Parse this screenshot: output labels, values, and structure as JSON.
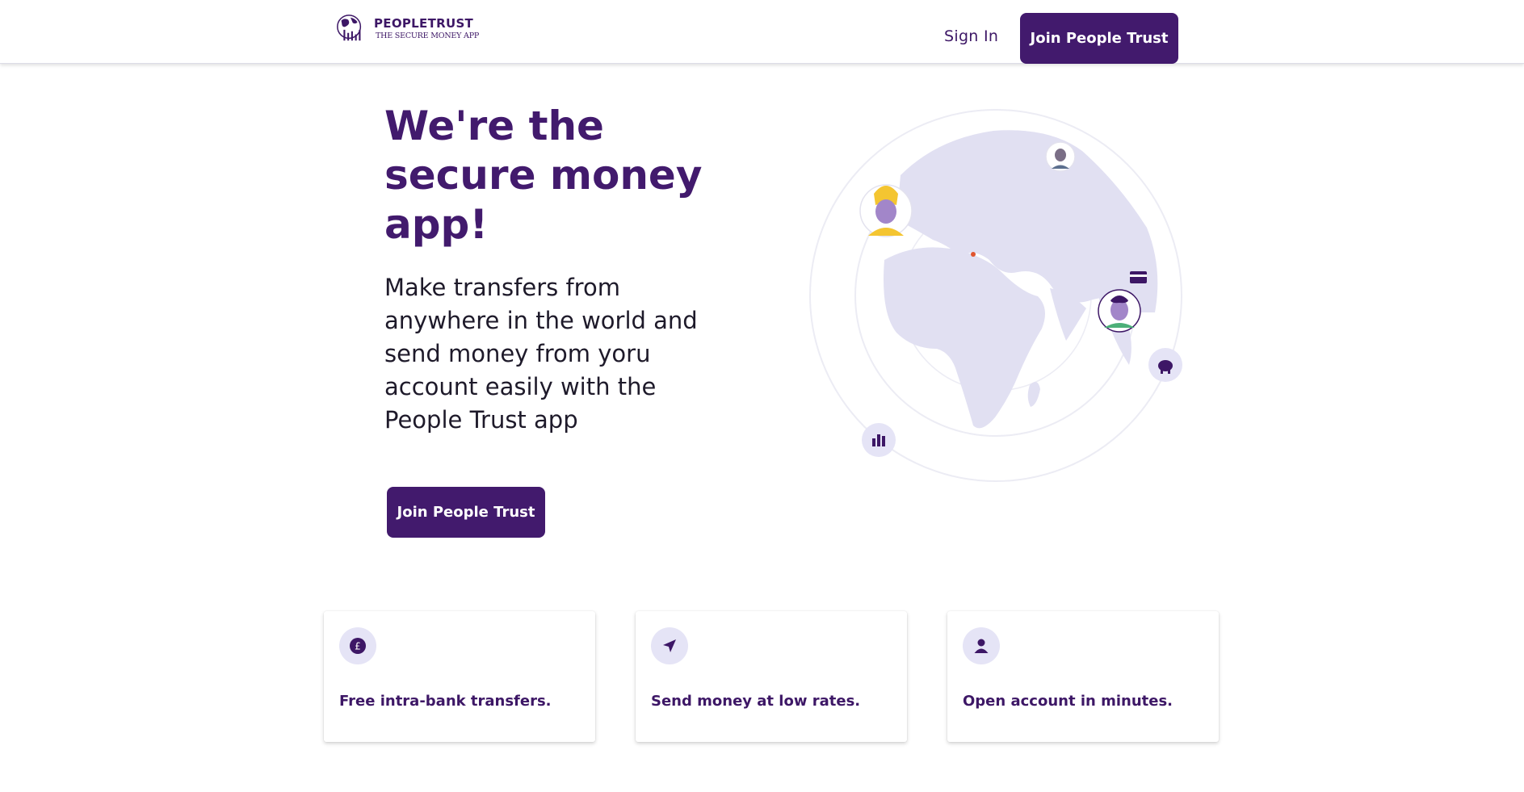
{
  "header": {
    "brand_name": "PEOPLETRUST",
    "brand_tagline": "THE SECURE MONEY APP",
    "signin_label": "Sign In",
    "join_label": "Join People Trust"
  },
  "hero": {
    "title": "We're the secure money app!",
    "description": "Make transfers from anywhere in the world and send money from yoru account easily with the People Trust app",
    "join_label": "Join People Trust"
  },
  "features": [
    {
      "icon": "pound-icon",
      "text": "Free intra-bank transfers."
    },
    {
      "icon": "send-icon",
      "text": "Send money at low rates."
    },
    {
      "icon": "user-icon",
      "text": "Open account in minutes."
    }
  ],
  "colors": {
    "brand": "#421a6d",
    "accent_light": "#e5e4f6",
    "map": "#e1e0f2"
  }
}
